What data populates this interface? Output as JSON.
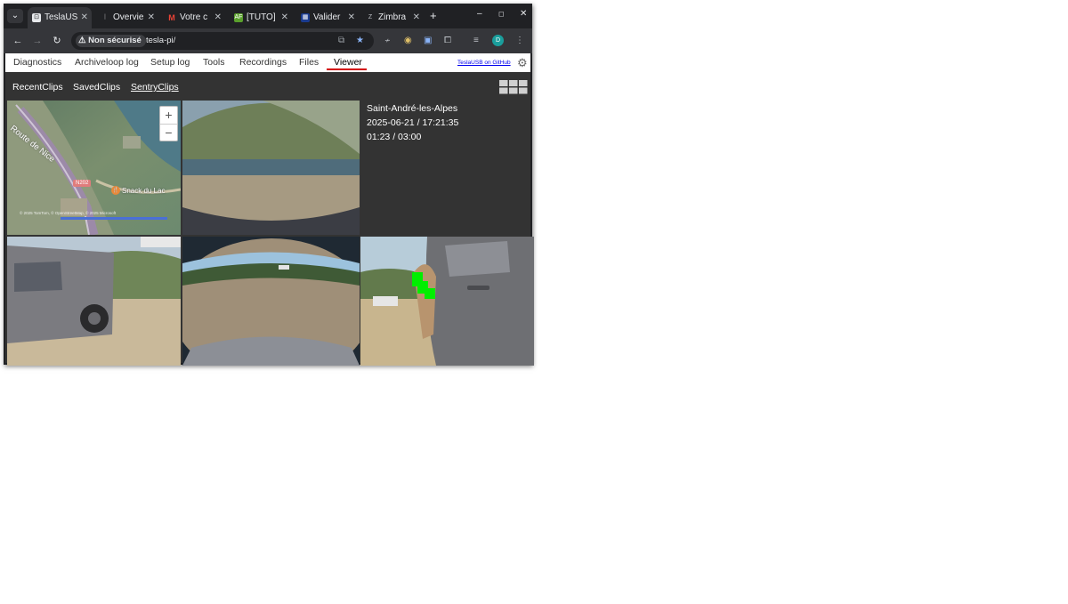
{
  "browser": {
    "tabs": [
      {
        "title": "TeslaUS",
        "active": true,
        "favicon": "tesla-icon",
        "fav_color": "#e8eaed"
      },
      {
        "title": "Overvie",
        "active": false,
        "favicon": "overview-icon",
        "fav_color": "#5f6368"
      },
      {
        "title": "Votre c",
        "active": false,
        "favicon": "gmail-icon",
        "fav_color": "#ea4335"
      },
      {
        "title": "[TUTO]",
        "active": false,
        "favicon": "af-icon",
        "fav_color": "#5aa02c"
      },
      {
        "title": "Valider",
        "active": false,
        "favicon": "valider-icon",
        "fav_color": "#1a3b8f"
      },
      {
        "title": "Zimbra",
        "active": false,
        "favicon": "zimbra-icon",
        "fav_color": "#9aa0a6"
      }
    ],
    "security_label": "Non sécurisé",
    "url": "tesla-pi/"
  },
  "app": {
    "menu": [
      {
        "label": "Diagnostics"
      },
      {
        "label": "Archiveloop log"
      },
      {
        "label": "Setup log"
      },
      {
        "label": "Tools"
      },
      {
        "label": "Recordings"
      },
      {
        "label": "Files"
      },
      {
        "label": "Viewer",
        "active": true
      }
    ],
    "github_link": "TeslaUSB on GitHub",
    "submenu": [
      {
        "label": "RecentClips"
      },
      {
        "label": "SavedClips"
      },
      {
        "label": "SentryClips",
        "active": true
      }
    ],
    "clip_info": {
      "location": "Saint-André-les-Alpes",
      "datetime": "2025-06-21 / 17:21:35",
      "time": "01:23 / 03:00"
    },
    "map": {
      "road_label": "Route de Nice",
      "road_badge": "N202",
      "poi_label": "Snack du Lac",
      "zoom_in": "+",
      "zoom_out": "−",
      "attribution": "© 2025 TomTom, © OpenStreetMap, © 2025 Microsoft"
    },
    "accent_color": "#d40000"
  }
}
